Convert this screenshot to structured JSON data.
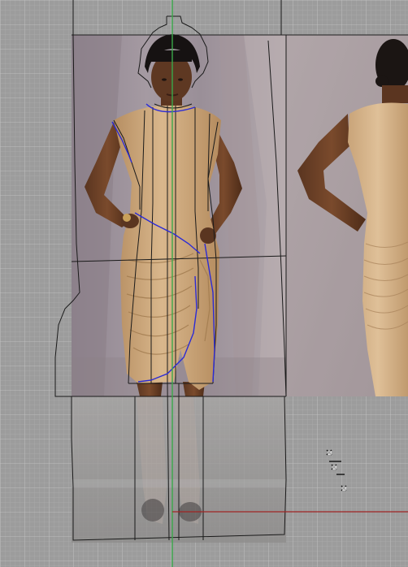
{
  "canvas": {
    "background": "#9c9c9c",
    "grid_color": "#b4b4b4",
    "grid_major_color": "#c2c2c2"
  },
  "reference_images": [
    {
      "name": "front-view-photo",
      "description_icon": "dress-front-photo"
    },
    {
      "name": "back-view-photo",
      "description_icon": "dress-back-photo"
    }
  ],
  "pattern": {
    "outline_color": "#1a1a1a",
    "selected_edge_color": "#2b2bd6"
  },
  "axes": {
    "vertical_color": "#3aa84a",
    "horizontal_color": "#a02424"
  },
  "gizmo": {
    "icon": "transform-gizmo-icon"
  }
}
